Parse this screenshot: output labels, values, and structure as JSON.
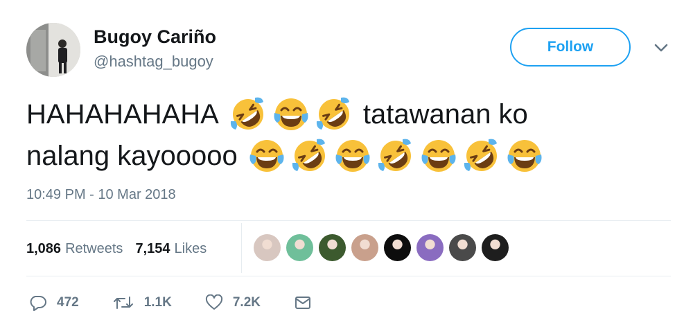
{
  "user": {
    "display_name": "Bugoy Cariño",
    "handle": "@hashtag_bugoy"
  },
  "follow_label": "Follow",
  "tweet": {
    "line1_before": "HAHAHAHAHA",
    "line1_emojis": [
      "rolling-on-floor-laughing",
      "face-with-tears-of-joy",
      "rolling-on-floor-laughing"
    ],
    "line1_after": "tatawanan ko",
    "line2_before": "nalang kayooooo",
    "line2_emojis": [
      "face-with-tears-of-joy",
      "rolling-on-floor-laughing",
      "face-with-tears-of-joy",
      "rolling-on-floor-laughing",
      "face-with-tears-of-joy",
      "rolling-on-floor-laughing",
      "face-with-tears-of-joy"
    ]
  },
  "timestamp": "10:49 PM - 10 Mar 2018",
  "stats": {
    "retweets_count": "1,086",
    "retweets_label": "Retweets",
    "likes_count": "7,154",
    "likes_label": "Likes"
  },
  "likers": [
    "#d8c7c0",
    "#6fbf9a",
    "#3c5a2e",
    "#c9a08c",
    "#0d0d0d",
    "#8a6cc0",
    "#4a4a4a",
    "#1e1e1e"
  ],
  "actions": {
    "reply_count": "472",
    "retweet_count": "1.1K",
    "like_count": "7.2K"
  },
  "colors": {
    "accent": "#1da1f2",
    "secondary_text": "#657786",
    "emoji_yellow": "#f8c13a",
    "tear_blue": "#5db4ec"
  }
}
